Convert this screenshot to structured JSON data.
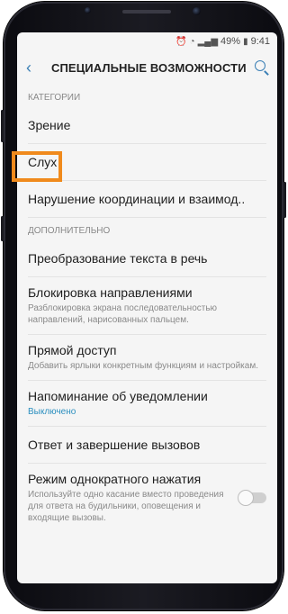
{
  "status": {
    "battery": "49%",
    "time": "9:41",
    "icons": [
      "alarm-icon",
      "wifi-icon",
      "signal-icon",
      "battery-icon"
    ]
  },
  "appbar": {
    "title": "СПЕЦИАЛЬНЫЕ ВОЗМОЖНОСТИ",
    "back_icon": "back-chevron-icon",
    "search_icon": "search-icon"
  },
  "sections": {
    "categories": "КАТЕГОРИИ",
    "extra": "ДОПОЛНИТЕЛЬНО"
  },
  "categories": [
    {
      "title": "Зрение"
    },
    {
      "title": "Слух"
    },
    {
      "title": "Нарушение координации и взаимод.."
    }
  ],
  "extra": [
    {
      "title": "Преобразование текста в речь"
    },
    {
      "title": "Блокировка направлениями",
      "subtitle": "Разблокировка экрана последовательностью направлений, нарисованных пальцем."
    },
    {
      "title": "Прямой доступ",
      "subtitle": "Добавить ярлыки конкретным функциям и настройкам."
    },
    {
      "title": "Напоминание об уведомлении",
      "subtitle": "Выключено"
    },
    {
      "title": "Ответ и завершение вызовов"
    },
    {
      "title": "Режим однократного нажатия",
      "subtitle": "Используйте одно касание вместо проведения для ответа на будильники, оповещения и входящие вызовы.",
      "toggle_on": false
    }
  ],
  "colors": {
    "accent": "#3a7fb5",
    "highlight": "#f08a1c",
    "status_text": "#2b8fbf"
  }
}
